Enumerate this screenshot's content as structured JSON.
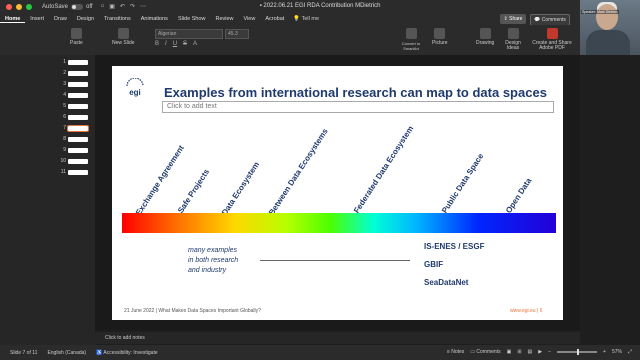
{
  "window": {
    "title": "2022.06.21 EGI RDA Contribution MDietrich",
    "autosave_label": "AutoSave",
    "autosave_state": "off"
  },
  "ribbon": {
    "tabs": [
      {
        "label": "Home"
      },
      {
        "label": "Insert"
      },
      {
        "label": "Draw"
      },
      {
        "label": "Design"
      },
      {
        "label": "Transitions"
      },
      {
        "label": "Animations"
      },
      {
        "label": "Slide Show"
      },
      {
        "label": "Review"
      },
      {
        "label": "View"
      },
      {
        "label": "Acrobat"
      }
    ],
    "tell_me": "Tell me",
    "share_label": "Share",
    "comments_label": "Comments"
  },
  "toolbar": {
    "paste": "Paste",
    "new_slide": "New Slide",
    "font_name": "Algerian",
    "font_size": "45.3",
    "convert": "Convert to SmartArt",
    "picture": "Picture",
    "drawing": "Drawing",
    "design_ideas": "Design Ideas",
    "create_share": "Create and Share Adobe PDF"
  },
  "webcam": {
    "label": "Speaker: Mark Dietrich"
  },
  "slides": [
    {
      "num": "1"
    },
    {
      "num": "2"
    },
    {
      "num": "3"
    },
    {
      "num": "4"
    },
    {
      "num": "5"
    },
    {
      "num": "6"
    },
    {
      "num": "7"
    },
    {
      "num": "8"
    },
    {
      "num": "9"
    },
    {
      "num": "10"
    },
    {
      "num": "11"
    }
  ],
  "slide": {
    "title": "Examples from international research can map to data spaces",
    "subtitle_placeholder": "Click to add text",
    "spectrum_labels": [
      "Exchange Agreement",
      "Safe Projects",
      "Data Ecosystem",
      "Between Data Ecosystems",
      "Federated Data Ecosystem",
      "Public Data Space",
      "Open Data"
    ],
    "many_examples": [
      "many examples",
      "in both research",
      "and industry"
    ],
    "examples": [
      "IS-ENES / ESGF",
      "GBIF",
      "SeaDataNet"
    ],
    "footer_left": "21 June 2022  |  What Makes Data Spaces Important Globally?",
    "footer_right": "www.egi.eu  |  6"
  },
  "notes_placeholder": "Click to add notes",
  "status": {
    "slide_of": "Slide 7 of 11",
    "language": "English (Canada)",
    "accessibility": "Accessibility: Investigate",
    "notes": "Notes",
    "comments": "Comments",
    "zoom": "57%"
  },
  "colors": {
    "title_blue": "#1f3a6e",
    "accent_orange": "#e8743b"
  }
}
